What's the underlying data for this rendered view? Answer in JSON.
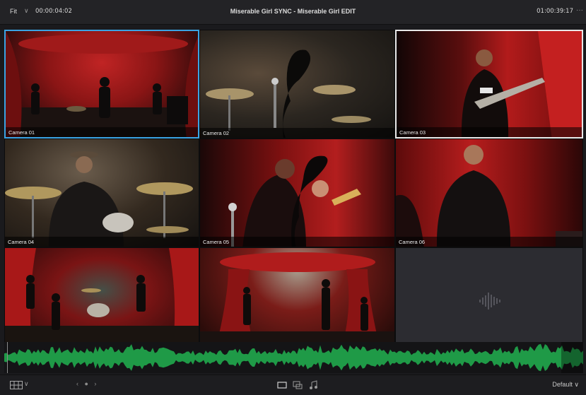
{
  "viewer": {
    "fit_label": "Fit",
    "fit_chevron": "∨",
    "timecode_left": "00:00:04:02",
    "title": "Miserable Girl SYNC - Miserable Girl EDIT",
    "timecode_right": "01:00:39:17",
    "more_icon": "···"
  },
  "angles": [
    {
      "label": "Camera 01",
      "state": "active"
    },
    {
      "label": "Camera 02",
      "state": "normal"
    },
    {
      "label": "Camera 03",
      "state": "preview"
    },
    {
      "label": "Camera 04",
      "state": "normal"
    },
    {
      "label": "Camera 05",
      "state": "normal"
    },
    {
      "label": "Camera 06",
      "state": "normal"
    },
    {
      "label": "",
      "state": "normal"
    },
    {
      "label": "",
      "state": "normal"
    },
    {
      "label": "",
      "state": "audio"
    }
  ],
  "colors": {
    "active_border": "#3aa3e3",
    "preview_border": "#e8e8e8",
    "waveform": "#1f9a47"
  },
  "bottombar": {
    "layout_icon": "grid-layout-icon",
    "layout_chevron": "∨",
    "page_nav": "‹ ● ›",
    "default_label": "Default",
    "default_chevron": "∨"
  }
}
